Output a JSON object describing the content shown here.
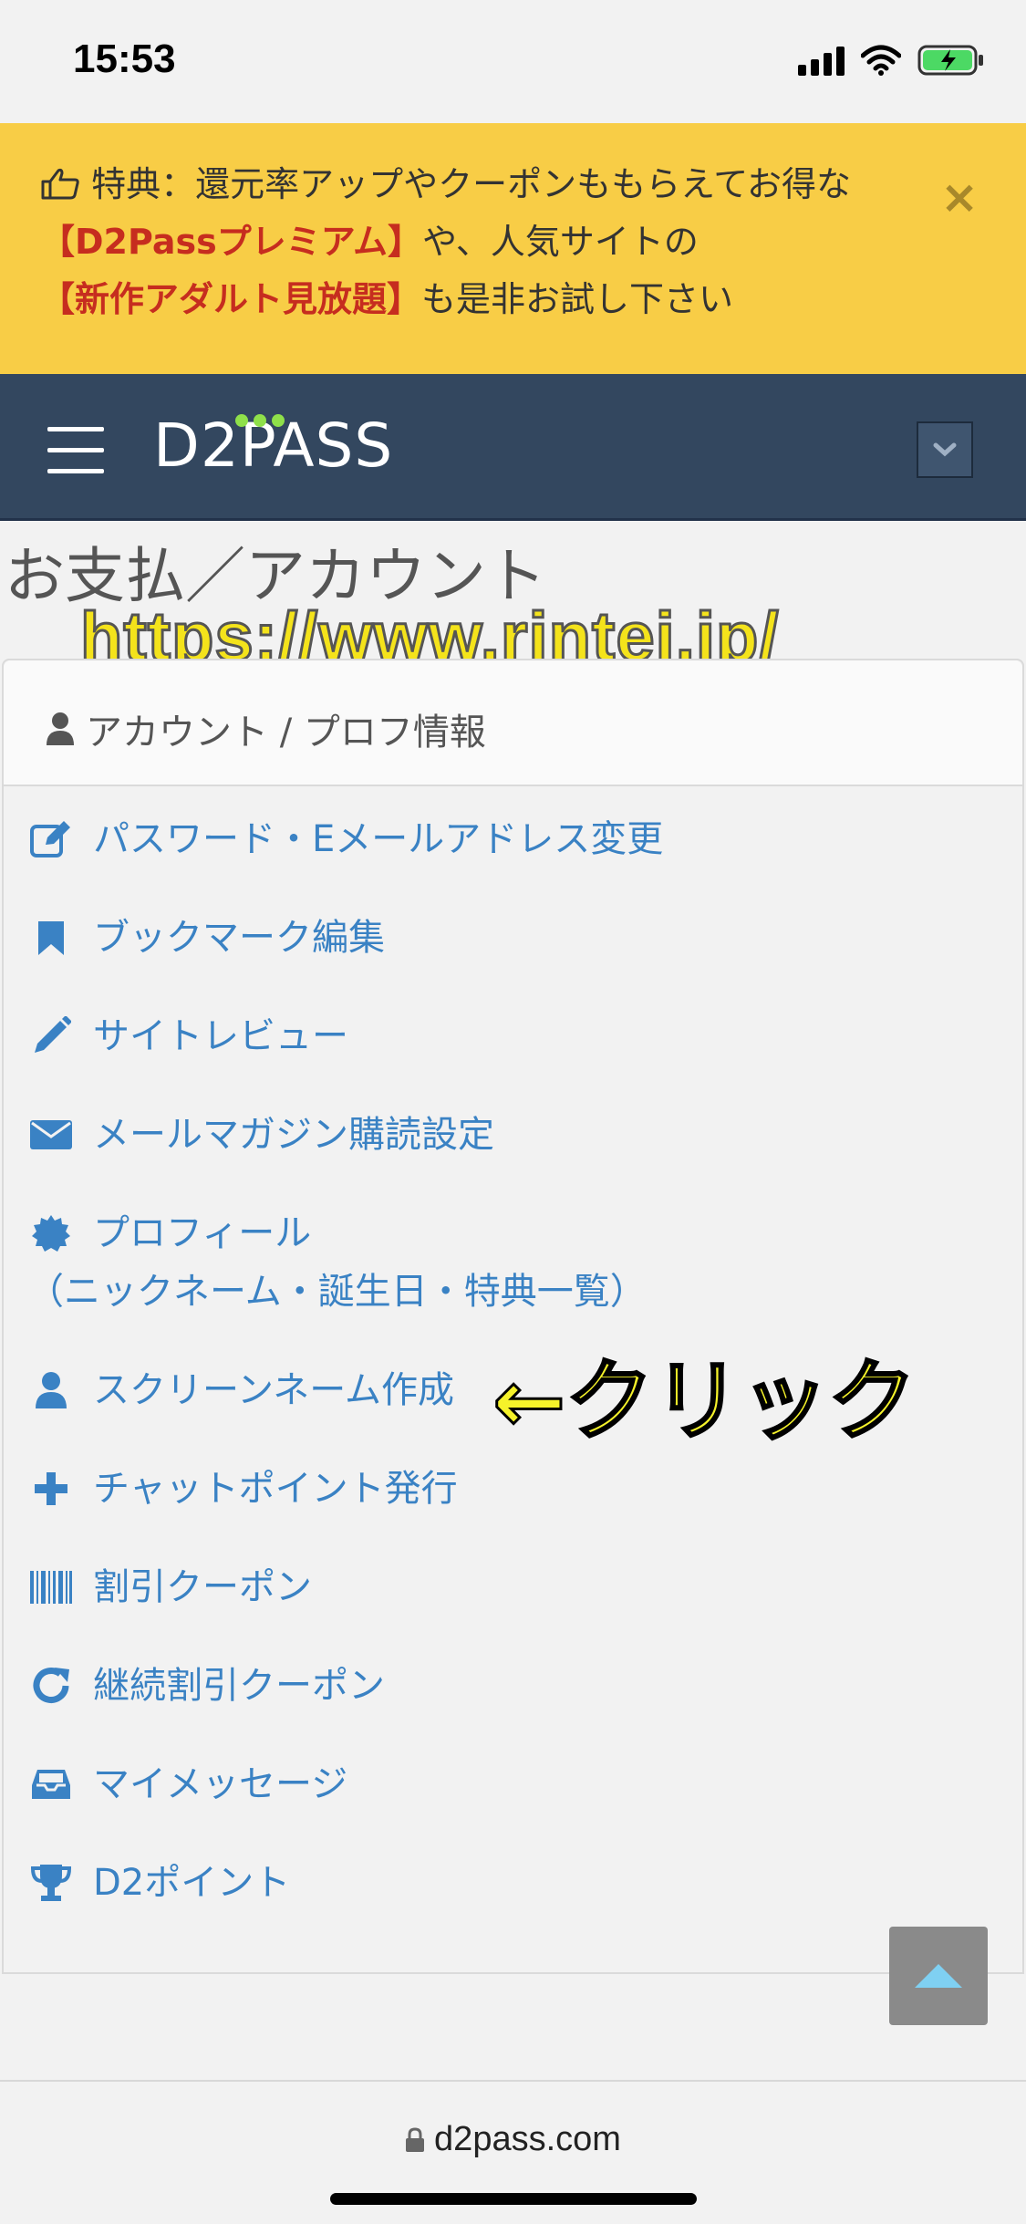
{
  "status": {
    "time": "15:53"
  },
  "promo": {
    "prefix": "特典：還元率アップやクーポンももらえてお得な",
    "highlight1": "【D2Passプレミアム】",
    "middle": "や、人気サイトの",
    "highlight2": "【新作アダルト見放題】",
    "suffix": "も是非お試し下さい",
    "close": "×"
  },
  "navbar": {
    "logo": "D2PASS"
  },
  "page": {
    "title": "お支払／アカウント",
    "watermark": "https://www.rintei.jp/"
  },
  "panel": {
    "heading": "アカウント / プロフ情報",
    "items": [
      {
        "label": "パスワード・Eメールアドレス変更",
        "icon": "edit-icon"
      },
      {
        "label": "ブックマーク編集",
        "icon": "bookmark-icon"
      },
      {
        "label": "サイトレビュー",
        "icon": "pencil-icon"
      },
      {
        "label": "メールマガジン購読設定",
        "icon": "envelope-icon"
      },
      {
        "label": "プロフィール",
        "label2": "（ニックネーム・誕生日・特典一覧）",
        "icon": "badge-icon"
      },
      {
        "label": "スクリーンネーム作成",
        "icon": "user-icon"
      },
      {
        "label": "チャットポイント発行",
        "icon": "plus-icon"
      },
      {
        "label": "割引クーポン",
        "icon": "barcode-icon"
      },
      {
        "label": "継続割引クーポン",
        "icon": "refresh-icon"
      },
      {
        "label": "マイメッセージ",
        "icon": "inbox-icon"
      },
      {
        "label": "D2ポイント",
        "icon": "trophy-icon"
      }
    ]
  },
  "annotation": "←クリック",
  "browser": {
    "url": "d2pass.com"
  },
  "colors": {
    "promo_bg": "#f8cd46",
    "navbar_bg": "#33475f",
    "link": "#3a82c4",
    "highlight": "#c62d1f"
  }
}
